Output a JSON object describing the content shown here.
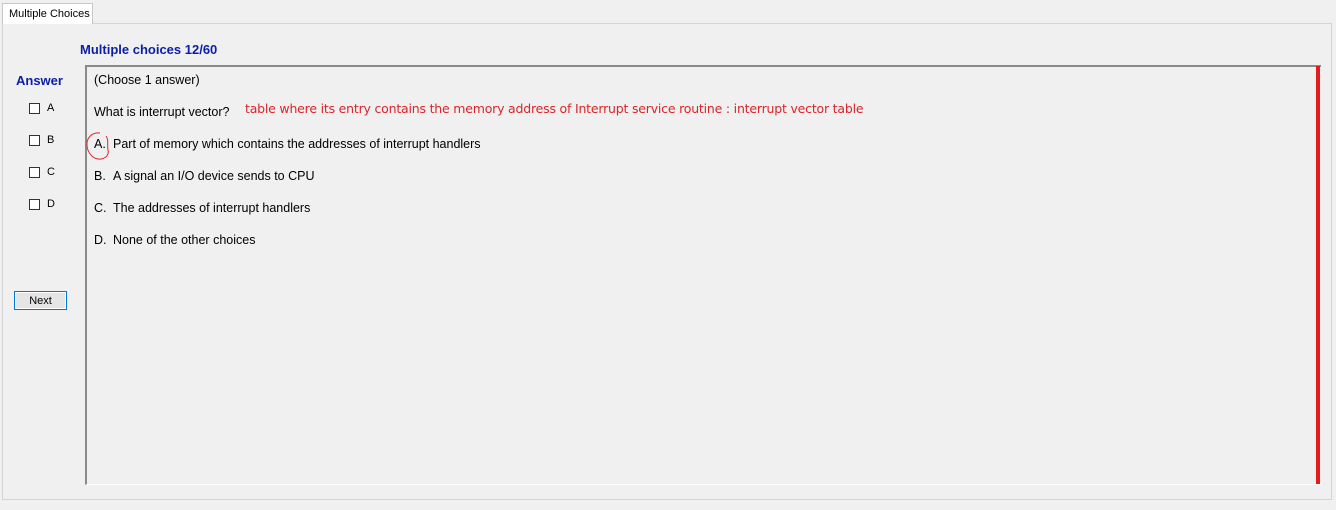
{
  "tab": {
    "label": "Multiple Choices"
  },
  "header": {
    "title": "Multiple choices 12/60"
  },
  "answer_panel": {
    "label": "Answer",
    "options": [
      {
        "label": "A",
        "checked": false
      },
      {
        "label": "B",
        "checked": false
      },
      {
        "label": "C",
        "checked": false
      },
      {
        "label": "D",
        "checked": false
      }
    ],
    "next_label": "Next"
  },
  "question": {
    "instruction": "(Choose 1 answer)",
    "text": "What is interrupt vector?",
    "choices": [
      {
        "letter": "A.",
        "text": "Part of memory which contains the addresses of interrupt handlers"
      },
      {
        "letter": "B.",
        "text": "A signal an I/O device sends to CPU"
      },
      {
        "letter": "C.",
        "text": "The addresses of interrupt handlers"
      },
      {
        "letter": "D.",
        "text": "None of the other choices"
      }
    ]
  },
  "annotation": {
    "text": "table where its entry contains the memory address of Interrupt service routine : interrupt vector table",
    "color": "#d8262a"
  },
  "colors": {
    "title": "#0a1fa8",
    "scroll_marker": "#e41c1c",
    "button_border": "#0078d7"
  }
}
